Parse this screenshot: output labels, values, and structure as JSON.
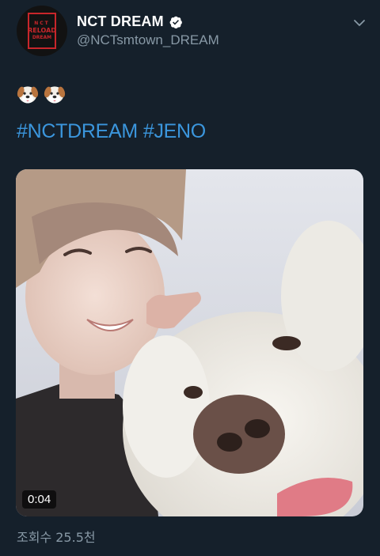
{
  "account": {
    "display_name": "NCT DREAM",
    "handle": "@NCTsmtown_DREAM",
    "verified": true,
    "avatar_logo": {
      "line1": "NCT",
      "line2": "RELOAD",
      "line3": "DREAM"
    }
  },
  "tweet": {
    "emojis": [
      "dog-face-emoji",
      "dog-face-emoji"
    ],
    "hashtags": [
      "#NCTDREAM",
      "#JENO"
    ],
    "media": {
      "type": "video",
      "duration": "0:04"
    },
    "view_count": "조회수 25.5천"
  },
  "colors": {
    "background": "#15202b",
    "link": "#3b96dd",
    "secondary_text": "#8899a6",
    "verified_badge": "#ffffff",
    "logo_red": "#c8262b"
  },
  "icons": {
    "verified": "verified-badge-icon",
    "menu": "chevron-down-icon"
  }
}
